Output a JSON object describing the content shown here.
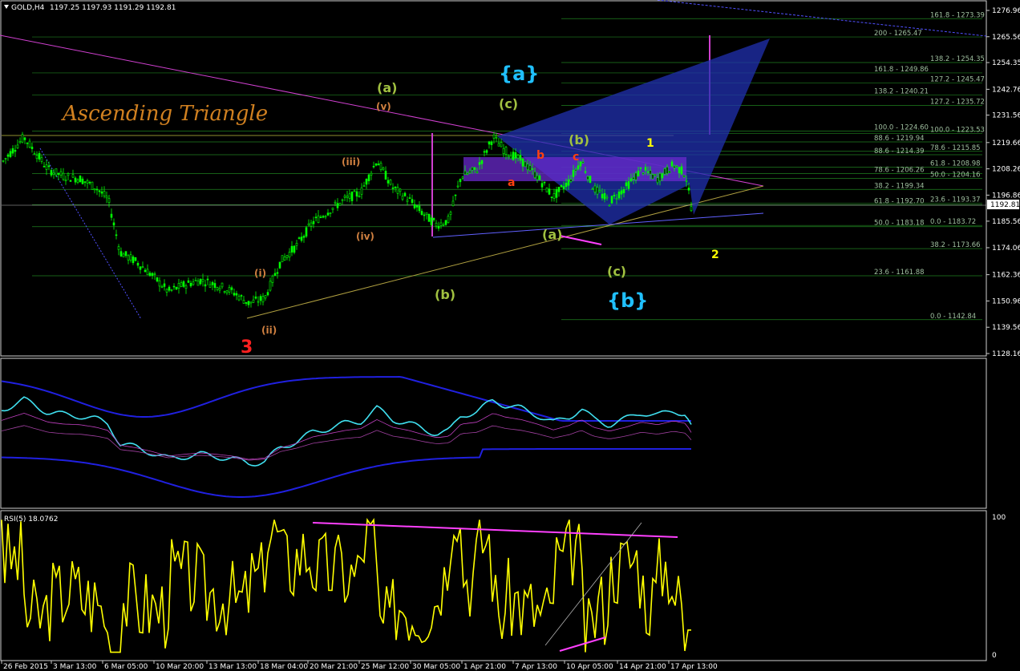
{
  "header": {
    "symbol": "GOLD,H4",
    "ohlc": "1197.25 1197.93 1191.29 1192.81"
  },
  "annotation_title": "Ascending Triangle",
  "rsi_label": "RSI(5) 18.0762",
  "colors": {
    "background": "#000000",
    "frame": "#e0e0e0",
    "grid_line": "#1f6f1f",
    "bull_candle": "#00ff00",
    "bear_candle": "#00ff00",
    "triangle_line": "#d040d0",
    "rsi_line": "#ffff00",
    "bands_outer": "#2020e0",
    "bands_price": "#40e0f0",
    "title_color": "#d08020"
  },
  "chart_data": [
    {
      "type": "line",
      "name": "price",
      "title": "GOLD,H4",
      "ylim": [
        1128.16,
        1276.96
      ],
      "current_price": "1192.81",
      "price_axis": [
        "1276.96",
        "1265.56",
        "1254.35",
        "1242.76",
        "1231.56",
        "1219.66",
        "1208.26",
        "1196.86",
        "1185.56",
        "1174.06",
        "1162.36",
        "1150.96",
        "1139.56",
        "1128.16"
      ],
      "fib_levels": [
        {
          "label": "161.8 - 1273.39",
          "value": 1273.39
        },
        {
          "label": "200 - 1265.47",
          "value": 1265.47
        },
        {
          "label": "138.2 - 1254.35",
          "value": 1254.35
        },
        {
          "label": "161.8 - 1249.86",
          "value": 1249.86
        },
        {
          "label": "127.2 - 1245.47",
          "value": 1245.47
        },
        {
          "label": "138.2 - 1240.21",
          "value": 1240.21
        },
        {
          "label": "127.2 - 1235.72",
          "value": 1235.72
        },
        {
          "label": "100.0 - 1224.60",
          "value": 1224.6
        },
        {
          "label": "100.0 - 1223.53",
          "value": 1223.53
        },
        {
          "label": "88.6 - 1219.94",
          "value": 1219.94
        },
        {
          "label": "78.6 - 1215.85",
          "value": 1215.85
        },
        {
          "label": "88.6 - 1214.39",
          "value": 1214.39
        },
        {
          "label": "61.8 - 1208.98",
          "value": 1208.98
        },
        {
          "label": "78.6 - 1206.26",
          "value": 1206.26
        },
        {
          "label": "50.0 - 1204.16",
          "value": 1204.16
        },
        {
          "label": "38.2 - 1199.34",
          "value": 1199.34
        },
        {
          "label": "23.6 - 1193.37",
          "value": 1193.37
        },
        {
          "label": "61.8 - 1192.70",
          "value": 1192.7
        },
        {
          "label": "0.0 - 1183.72",
          "value": 1183.72
        },
        {
          "label": "50.0 - 1183.18",
          "value": 1183.18
        },
        {
          "label": "38.2 - 1173.66",
          "value": 1173.66
        },
        {
          "label": "23.6 - 1161.88",
          "value": 1161.88
        },
        {
          "label": "0.0 - 1142.84",
          "value": 1142.84
        }
      ],
      "wave_labels": [
        {
          "text": "3",
          "color": "#ff2020"
        },
        {
          "text": "(a)",
          "color": "#a0c040"
        },
        {
          "text": "(b)",
          "color": "#a0c040"
        },
        {
          "text": "(c)",
          "color": "#a0c040"
        },
        {
          "text": "{a}",
          "color": "#20c0ff"
        },
        {
          "text": "{b}",
          "color": "#20c0ff"
        },
        {
          "text": "(a)",
          "color": "#a0c040"
        },
        {
          "text": "(b)",
          "color": "#a0c040"
        },
        {
          "text": "(c)",
          "color": "#a0c040"
        },
        {
          "text": "1",
          "color": "#ffff00"
        },
        {
          "text": "2",
          "color": "#ffff00"
        },
        {
          "text": "a",
          "color": "#ff4010"
        },
        {
          "text": "b",
          "color": "#ff4010"
        },
        {
          "text": "c",
          "color": "#ff4010"
        },
        {
          "text": "(i)",
          "color": "#d08040"
        },
        {
          "text": "(ii)",
          "color": "#d08040"
        },
        {
          "text": "(iii)",
          "color": "#d08040"
        },
        {
          "text": "(iv)",
          "color": "#d08040"
        },
        {
          "text": "(v)",
          "color": "#d08040"
        }
      ],
      "time_axis": [
        "26 Feb 2015",
        "3 Mar 13:00",
        "6 Mar 05:00",
        "10 Mar 20:00",
        "13 Mar 13:00",
        "18 Mar 04:00",
        "20 Mar 21:00",
        "25 Mar 12:00",
        "30 Mar 05:00",
        "1 Apr 21:00",
        "7 Apr 13:00",
        "10 Apr 05:00",
        "14 Apr 21:00",
        "17 Apr 13:00"
      ]
    },
    {
      "type": "line",
      "name": "rsi",
      "title": "RSI(5) 18.0762",
      "ylim": [
        0,
        100
      ],
      "axis_labels": [
        "100",
        "0"
      ],
      "current_value": 18.0762
    }
  ]
}
